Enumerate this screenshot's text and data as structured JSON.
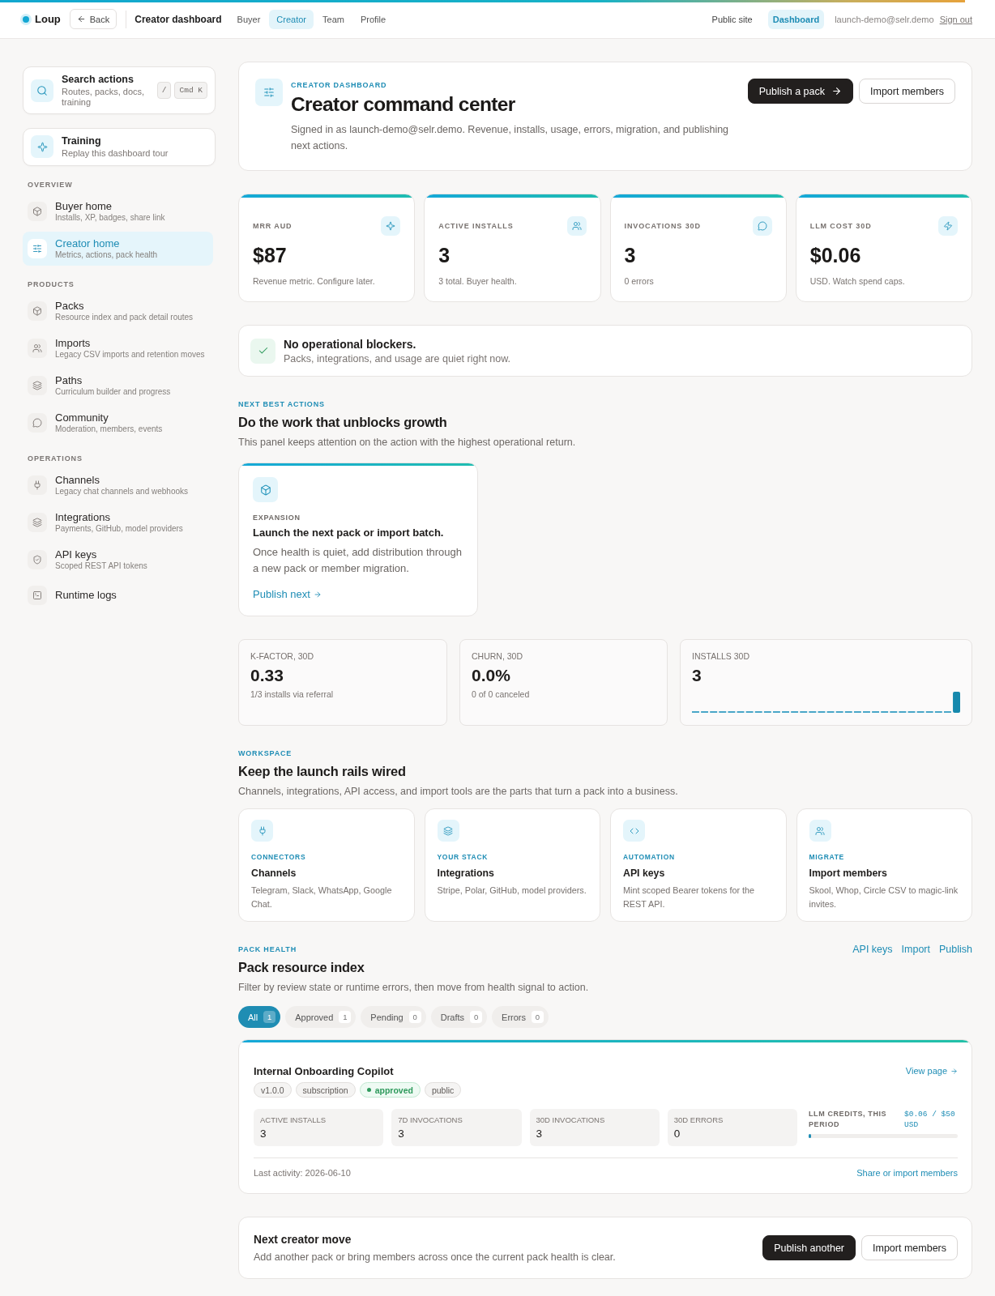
{
  "header": {
    "logo": "Loup",
    "back": "Back",
    "title": "Creator dashboard",
    "tabs": [
      {
        "label": "Buyer",
        "selected": false
      },
      {
        "label": "Creator",
        "selected": true
      },
      {
        "label": "Team",
        "selected": false
      },
      {
        "label": "Profile",
        "selected": false
      }
    ],
    "right_links": [
      {
        "label": "Public site",
        "selected": false
      },
      {
        "label": "Dashboard",
        "selected": true
      }
    ],
    "email": "launch-demo@selr.demo",
    "sign_out": "Sign out"
  },
  "sidebar": {
    "search": {
      "title": "Search actions",
      "subtitle": "Routes, packs, docs, training",
      "keys": [
        "/",
        "Cmd K"
      ]
    },
    "training": {
      "title": "Training",
      "subtitle": "Replay this dashboard tour"
    },
    "groups": [
      {
        "label": "OVERVIEW",
        "items": [
          {
            "title": "Buyer home",
            "subtitle": "Installs, XP, badges, share link",
            "selected": false
          },
          {
            "title": "Creator home",
            "subtitle": "Metrics, actions, pack health",
            "selected": true
          }
        ]
      },
      {
        "label": "PRODUCTS",
        "items": [
          {
            "title": "Packs",
            "subtitle": "Resource index and pack detail routes",
            "selected": false
          },
          {
            "title": "Imports",
            "subtitle": "Legacy CSV imports and retention moves",
            "selected": false
          },
          {
            "title": "Paths",
            "subtitle": "Curriculum builder and progress",
            "selected": false
          },
          {
            "title": "Community",
            "subtitle": "Moderation, members, events",
            "selected": false
          }
        ]
      },
      {
        "label": "OPERATIONS",
        "items": [
          {
            "title": "Channels",
            "subtitle": "Legacy chat channels and webhooks",
            "selected": false
          },
          {
            "title": "Integrations",
            "subtitle": "Payments, GitHub, model providers",
            "selected": false
          },
          {
            "title": "API keys",
            "subtitle": "Scoped REST API tokens",
            "selected": false
          },
          {
            "title": "Runtime logs",
            "selected": false
          }
        ]
      }
    ]
  },
  "hero": {
    "eyebrow": "CREATOR DASHBOARD",
    "title": "Creator command center",
    "description": "Signed in as launch-demo@selr.demo. Revenue, installs, usage, errors, migration, and publishing next actions.",
    "buttons": [
      {
        "label": "Publish a pack",
        "kind": "primary"
      },
      {
        "label": "Import members",
        "kind": "secondary"
      }
    ]
  },
  "metrics": [
    {
      "label": "MRR AUD",
      "value": "$87",
      "note": "Revenue metric. Configure later."
    },
    {
      "label": "ACTIVE INSTALLS",
      "value": "3",
      "note": "3 total. Buyer health."
    },
    {
      "label": "INVOCATIONS 30D",
      "value": "3",
      "note": "0 errors"
    },
    {
      "label": "LLM COST 30D",
      "value": "$0.06",
      "note": "USD. Watch spend caps."
    }
  ],
  "blocker": {
    "title": "No operational blockers.",
    "message": "Packs, integrations, and usage are quiet right now."
  },
  "next_actions": {
    "eyebrow": "NEXT BEST ACTIONS",
    "title": "Do the work that unblocks growth",
    "description": "This panel keeps attention on the action with the highest operational return.",
    "cards": [
      {
        "eyebrow": "EXPANSION",
        "title": "Launch the next pack or import batch.",
        "description": "Once health is quiet, add distribution through a new pack or member migration.",
        "link": "Publish next"
      }
    ]
  },
  "stats": [
    {
      "kind": "text",
      "label": "K-FACTOR, 30D",
      "value": "0.33",
      "note": "1/3 installs via referral"
    },
    {
      "kind": "text",
      "label": "CHURN, 30D",
      "value": "0.0%",
      "note": "0 of 0 canceled"
    },
    {
      "kind": "chart",
      "label": "INSTALLS 30D",
      "value": "3"
    }
  ],
  "workspace": {
    "eyebrow": "WORKSPACE",
    "title": "Keep the launch rails wired",
    "description": "Channels, integrations, API access, and import tools are the parts that turn a pack into a business.",
    "cards": [
      {
        "eyebrow": "CONNECTORS",
        "title": "Channels",
        "description": "Telegram, Slack, WhatsApp, Google Chat."
      },
      {
        "eyebrow": "YOUR STACK",
        "title": "Integrations",
        "description": "Stripe, Polar, GitHub, model providers."
      },
      {
        "eyebrow": "AUTOMATION",
        "title": "API keys",
        "description": "Mint scoped Bearer tokens for the REST API."
      },
      {
        "eyebrow": "MIGRATE",
        "title": "Import members",
        "description": "Skool, Whop, Circle CSV to magic-link invites."
      }
    ]
  },
  "pack_health": {
    "eyebrow": "PACK HEALTH",
    "title": "Pack resource index",
    "description": "Filter by review state or runtime errors, then move from health signal to action.",
    "links": [
      "API keys",
      "Import",
      "Publish"
    ],
    "filters": [
      {
        "label": "All",
        "count": "1",
        "selected": true
      },
      {
        "label": "Approved",
        "count": "1",
        "selected": false
      },
      {
        "label": "Pending",
        "count": "0",
        "selected": false
      },
      {
        "label": "Drafts",
        "count": "0",
        "selected": false
      },
      {
        "label": "Errors",
        "count": "0",
        "selected": false
      }
    ],
    "packs": [
      {
        "name": "Internal Onboarding Copilot",
        "link": "View page",
        "tags": [
          {
            "label": "v1.0.0",
            "kind": "plain"
          },
          {
            "label": "subscription",
            "kind": "plain"
          },
          {
            "label": "approved",
            "kind": "status"
          },
          {
            "label": "public",
            "kind": "plain"
          }
        ],
        "stats": [
          {
            "label": "ACTIVE INSTALLS",
            "value": "3"
          },
          {
            "label": "7D INVOCATIONS",
            "value": "3"
          },
          {
            "label": "30D INVOCATIONS",
            "value": "3"
          },
          {
            "label": "30D ERRORS",
            "value": "0"
          }
        ],
        "credits": {
          "label": "LLM CREDITS, THIS PERIOD",
          "value": "$0.06 / $50 USD",
          "level": 0.0012
        },
        "last_activity": "Last activity: 2026-06-10",
        "footer_link": "Share or import members"
      }
    ]
  },
  "next_move": {
    "title": "Next creator move",
    "description": "Add another pack or bring members across once the current pack health is clear.",
    "buttons": [
      {
        "label": "Publish another",
        "kind": "primary"
      },
      {
        "label": "Import members",
        "kind": "secondary"
      }
    ]
  }
}
